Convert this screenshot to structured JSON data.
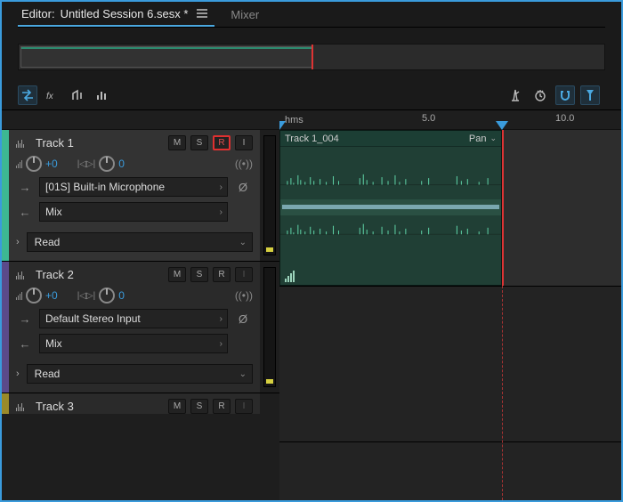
{
  "tabs": {
    "editor_label": "Editor:",
    "session_name": "Untitled Session 6.sesx *",
    "mixer_label": "Mixer"
  },
  "ruler": {
    "unit": "hms",
    "ticks": [
      "5.0",
      "10.0"
    ]
  },
  "clip": {
    "name": "Track 1_004",
    "pan_label": "Pan"
  },
  "tracks": [
    {
      "name": "Track 1",
      "msr": {
        "m": "M",
        "s": "S",
        "r": "R",
        "i": "I"
      },
      "vol": "+0",
      "pan": "0",
      "input": "[01S] Built-in Microphone",
      "output": "Mix",
      "automation": "Read",
      "armed": true,
      "color": "green"
    },
    {
      "name": "Track 2",
      "msr": {
        "m": "M",
        "s": "S",
        "r": "R",
        "i": "I"
      },
      "vol": "+0",
      "pan": "0",
      "input": "Default Stereo Input",
      "output": "Mix",
      "automation": "Read",
      "armed": false,
      "color": "purple"
    },
    {
      "name": "Track 3",
      "msr": {
        "m": "M",
        "s": "S",
        "r": "R",
        "i": "I"
      },
      "color": "olive"
    }
  ],
  "monitor_symbol": "((•))"
}
